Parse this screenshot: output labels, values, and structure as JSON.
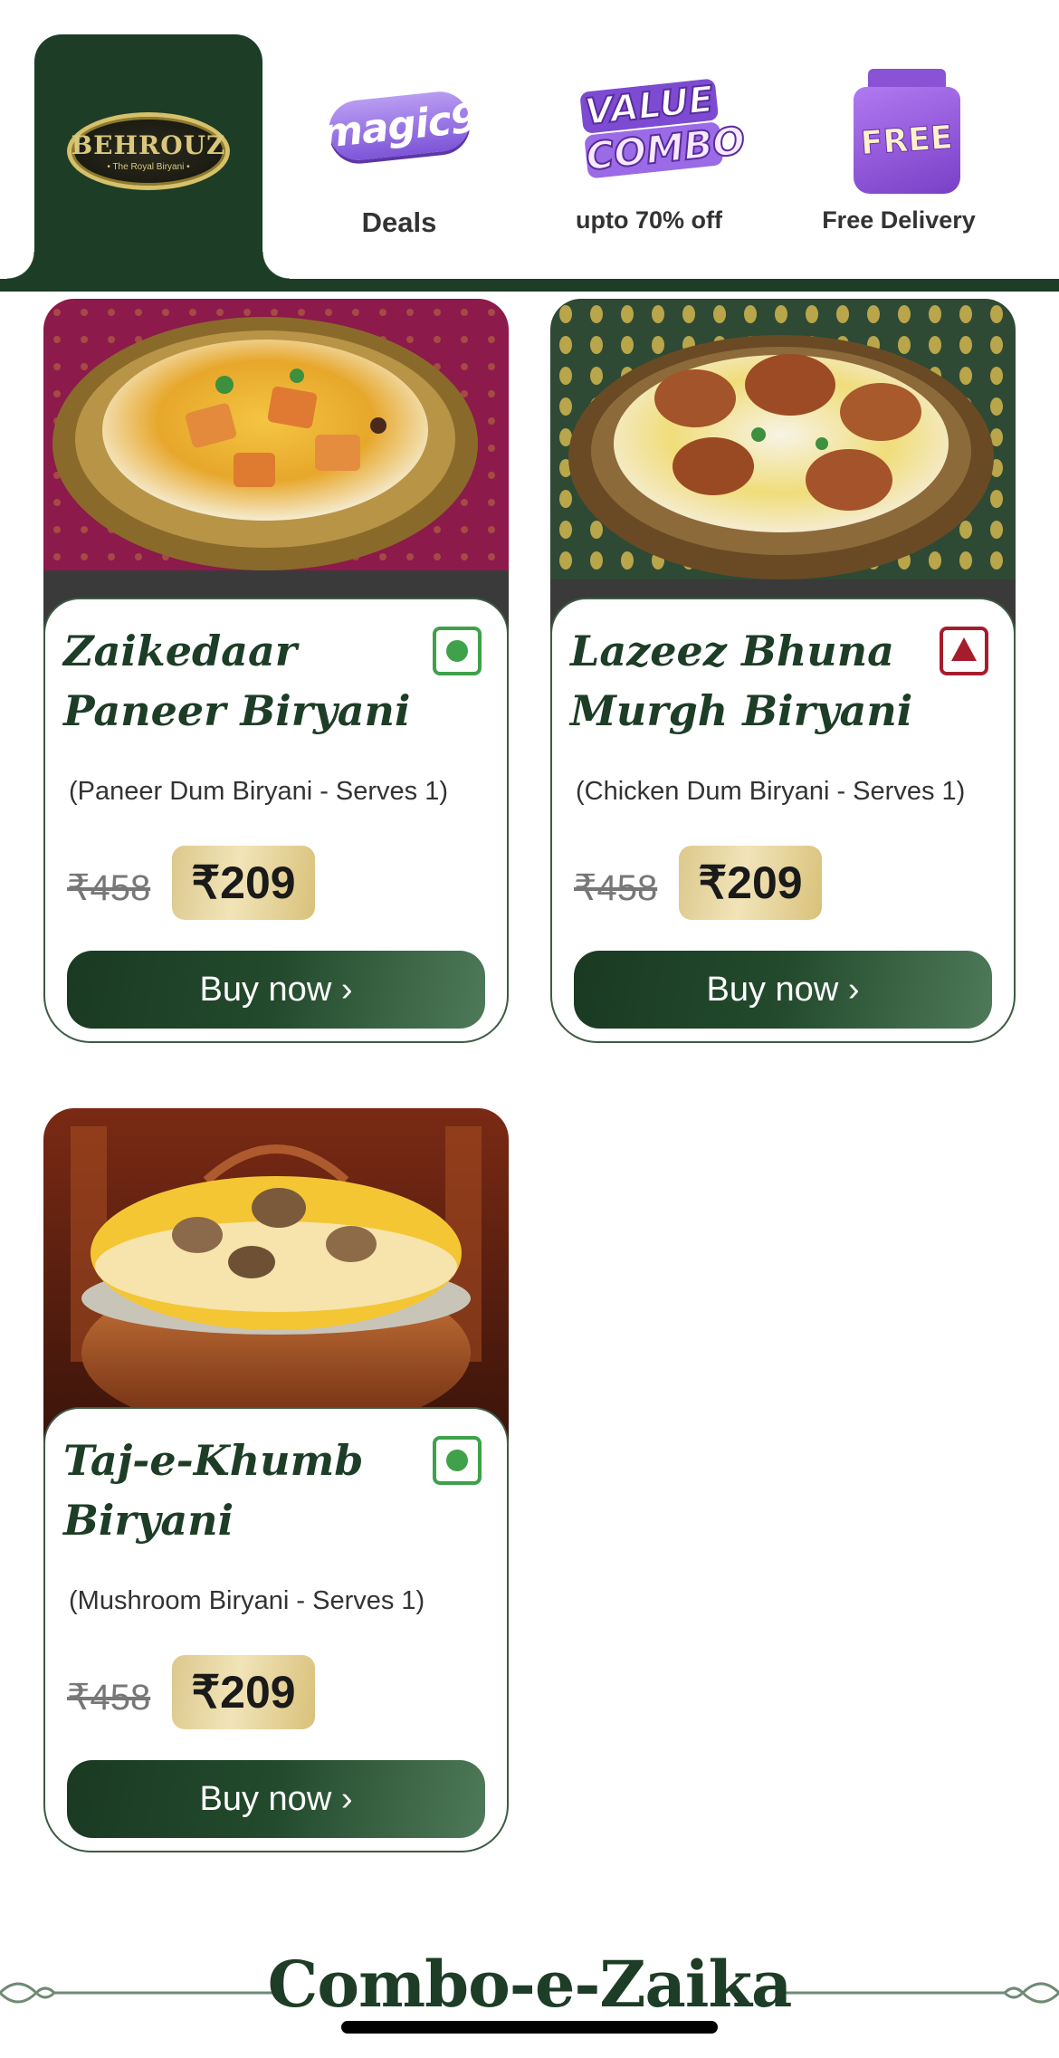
{
  "header": {
    "brand": {
      "name": "BEHROUZ",
      "tagline": "• The Royal Biryani •"
    },
    "nav": [
      {
        "badge": "magic9",
        "label": "Deals"
      },
      {
        "badge_line1": "VALUE",
        "badge_line2": "COMBO",
        "label": "upto 70% off"
      },
      {
        "badge": "FREE",
        "label": "Free Delivery"
      }
    ]
  },
  "products": [
    {
      "title_line1": "Zaikedaar",
      "title_line2": "Paneer Biryani",
      "subtitle": "(Paneer Dum Biryani - Serves 1)",
      "diet": "veg",
      "old_price": "₹458",
      "price": "₹209",
      "cta": "Buy now ›"
    },
    {
      "title_line1": "Lazeez Bhuna",
      "title_line2": "Murgh Biryani",
      "subtitle": "(Chicken Dum Biryani - Serves 1)",
      "diet": "non-veg",
      "old_price": "₹458",
      "price": "₹209",
      "cta": "Buy now ›"
    },
    {
      "title_line1": "Taj-e-Khumb",
      "title_line2": "Biryani",
      "subtitle": "(Mushroom Biryani - Serves 1)",
      "diet": "veg",
      "old_price": "₹458",
      "price": "₹209",
      "cta": "Buy now ›"
    }
  ],
  "section": {
    "title": "Combo-e-Zaika"
  },
  "colors": {
    "brand_green": "#1d3d26",
    "veg": "#3fa14a",
    "non_veg": "#a51d2d",
    "price_gold": "#e6d49c"
  }
}
